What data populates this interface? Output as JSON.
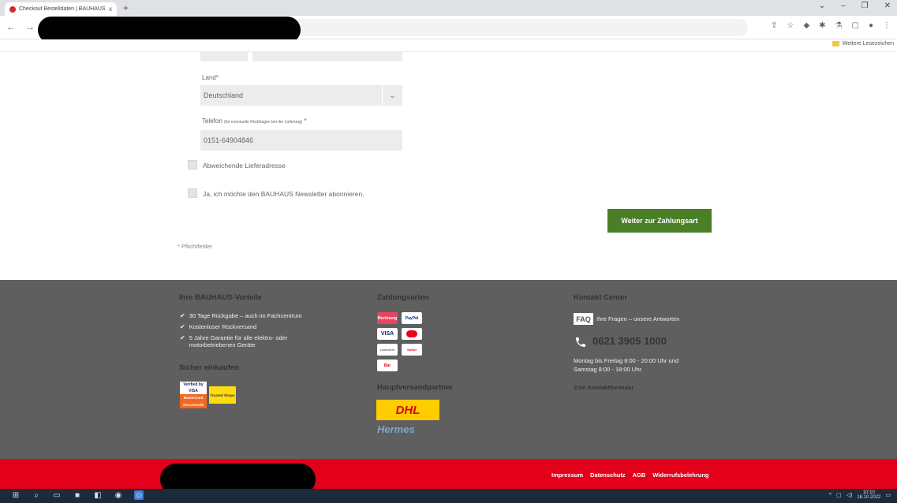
{
  "browser": {
    "tab_title": "Checkout Bestelldaten | BAUHAUS",
    "tab_close": "x",
    "new_tab": "+",
    "back": "←",
    "forward": "→",
    "bookmarks_folder": "Weitere Lesezeichen",
    "window_controls": [
      "⌄",
      "–",
      "❐",
      "✕"
    ]
  },
  "form": {
    "country_label": "Land*",
    "country_value": "Deutschland",
    "phone_label": "Telefon",
    "phone_hint": "(für eventuelle Rückfragen bei der Lieferung)",
    "phone_required": " *",
    "phone_value": "0151-64904846",
    "alt_address_label": "Abweichende Lieferadresse",
    "newsletter_label": "Ja, ich möchte den BAUHAUS Newsletter abonnieren.",
    "submit_label": "Weiter zur Zahlungsart",
    "required_note": "* Pflichtfelder"
  },
  "footer": {
    "advantages_title": "Ihre BAUHAUS-Vorteile",
    "advantages": [
      "30 Tage Rückgabe – auch im Fachcentrum",
      "Kostenloser Rückversand",
      "5 Jahre Garantie für alle elektro- oder motorbetriebenen Geräte"
    ],
    "secure_title": "Sicher einkaufen",
    "secure_badges": [
      "Verified by VISA",
      "MasterCard SecureCode",
      "Trusted Shops"
    ],
    "payment_title": "Zahlungsarten",
    "payment_methods": [
      "Rechnung",
      "PayPal",
      "VISA",
      "Mastercard",
      "Lastschrift",
      "Sofort",
      "Bar"
    ],
    "shipping_title": "Hauptversandpartner",
    "dhl": "DHL",
    "hermes": "Hermes",
    "contact_title": "Kontakt Center",
    "faq_badge": "FAQ",
    "faq_text": "Ihre Fragen – unsere Antworten",
    "phone": "0621 3905 1000",
    "hours_line1": "Montag bis Freitag 8:00 - 20:00 Uhr und",
    "hours_line2": "Samstag 8:00 - 18:00 Uhr.",
    "contact_form": "Zum Kontaktformular",
    "legal_links": [
      "Impressum",
      "Datenschutz",
      "AGB",
      "Widerrufsbelehrung"
    ]
  },
  "taskbar": {
    "time": "10:10",
    "date": "18.10.2022"
  },
  "colors": {
    "primary_green": "#4b7f26",
    "footer_gray": "#5f5f5f",
    "bauhaus_red": "#e2001a"
  }
}
